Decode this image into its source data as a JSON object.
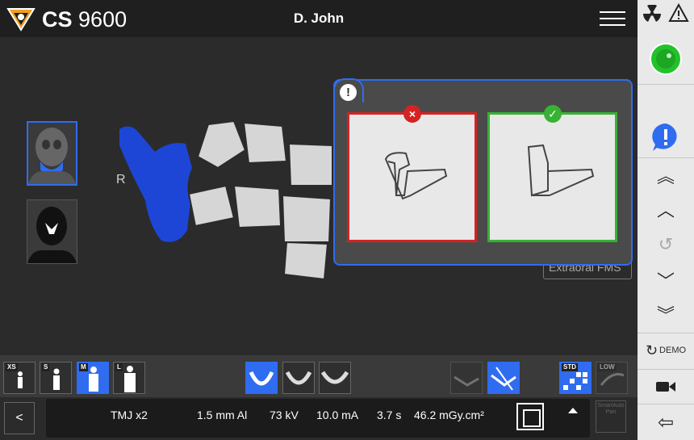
{
  "header": {
    "brand_bold": "CS",
    "brand_model": "9600",
    "patient_name": "D. John"
  },
  "main": {
    "side_label": "R",
    "popup_background_label": "Extraoral FMS"
  },
  "toolbar": {
    "size_tags": [
      "XS",
      "S",
      "M",
      "L"
    ],
    "selected_size": "M",
    "std_tag": "STD",
    "low_tag": "LOW"
  },
  "params": {
    "back_label": "<",
    "program": "TMJ x2",
    "filtration": "1.5 mm Al",
    "voltage": "73 kV",
    "current": "10.0 mA",
    "time": "3.7 s",
    "dose": "46.2 mGy.cm²",
    "smartauto_label": "SmartAuto Pan"
  },
  "rightpanel": {
    "demo_label": "DEMO"
  },
  "colors": {
    "accent": "#2f6cf0",
    "error": "#d42323",
    "ok": "#37b233",
    "status_green": "#22c32a"
  },
  "icons": [
    "radiation-icon",
    "warning-icon",
    "menu-icon",
    "exclamation-icon",
    "chevron-double-up-icon",
    "chevron-up-icon",
    "history-icon",
    "chevron-down-icon",
    "chevron-double-down-icon",
    "demo-icon",
    "camera-icon",
    "exit-icon"
  ]
}
